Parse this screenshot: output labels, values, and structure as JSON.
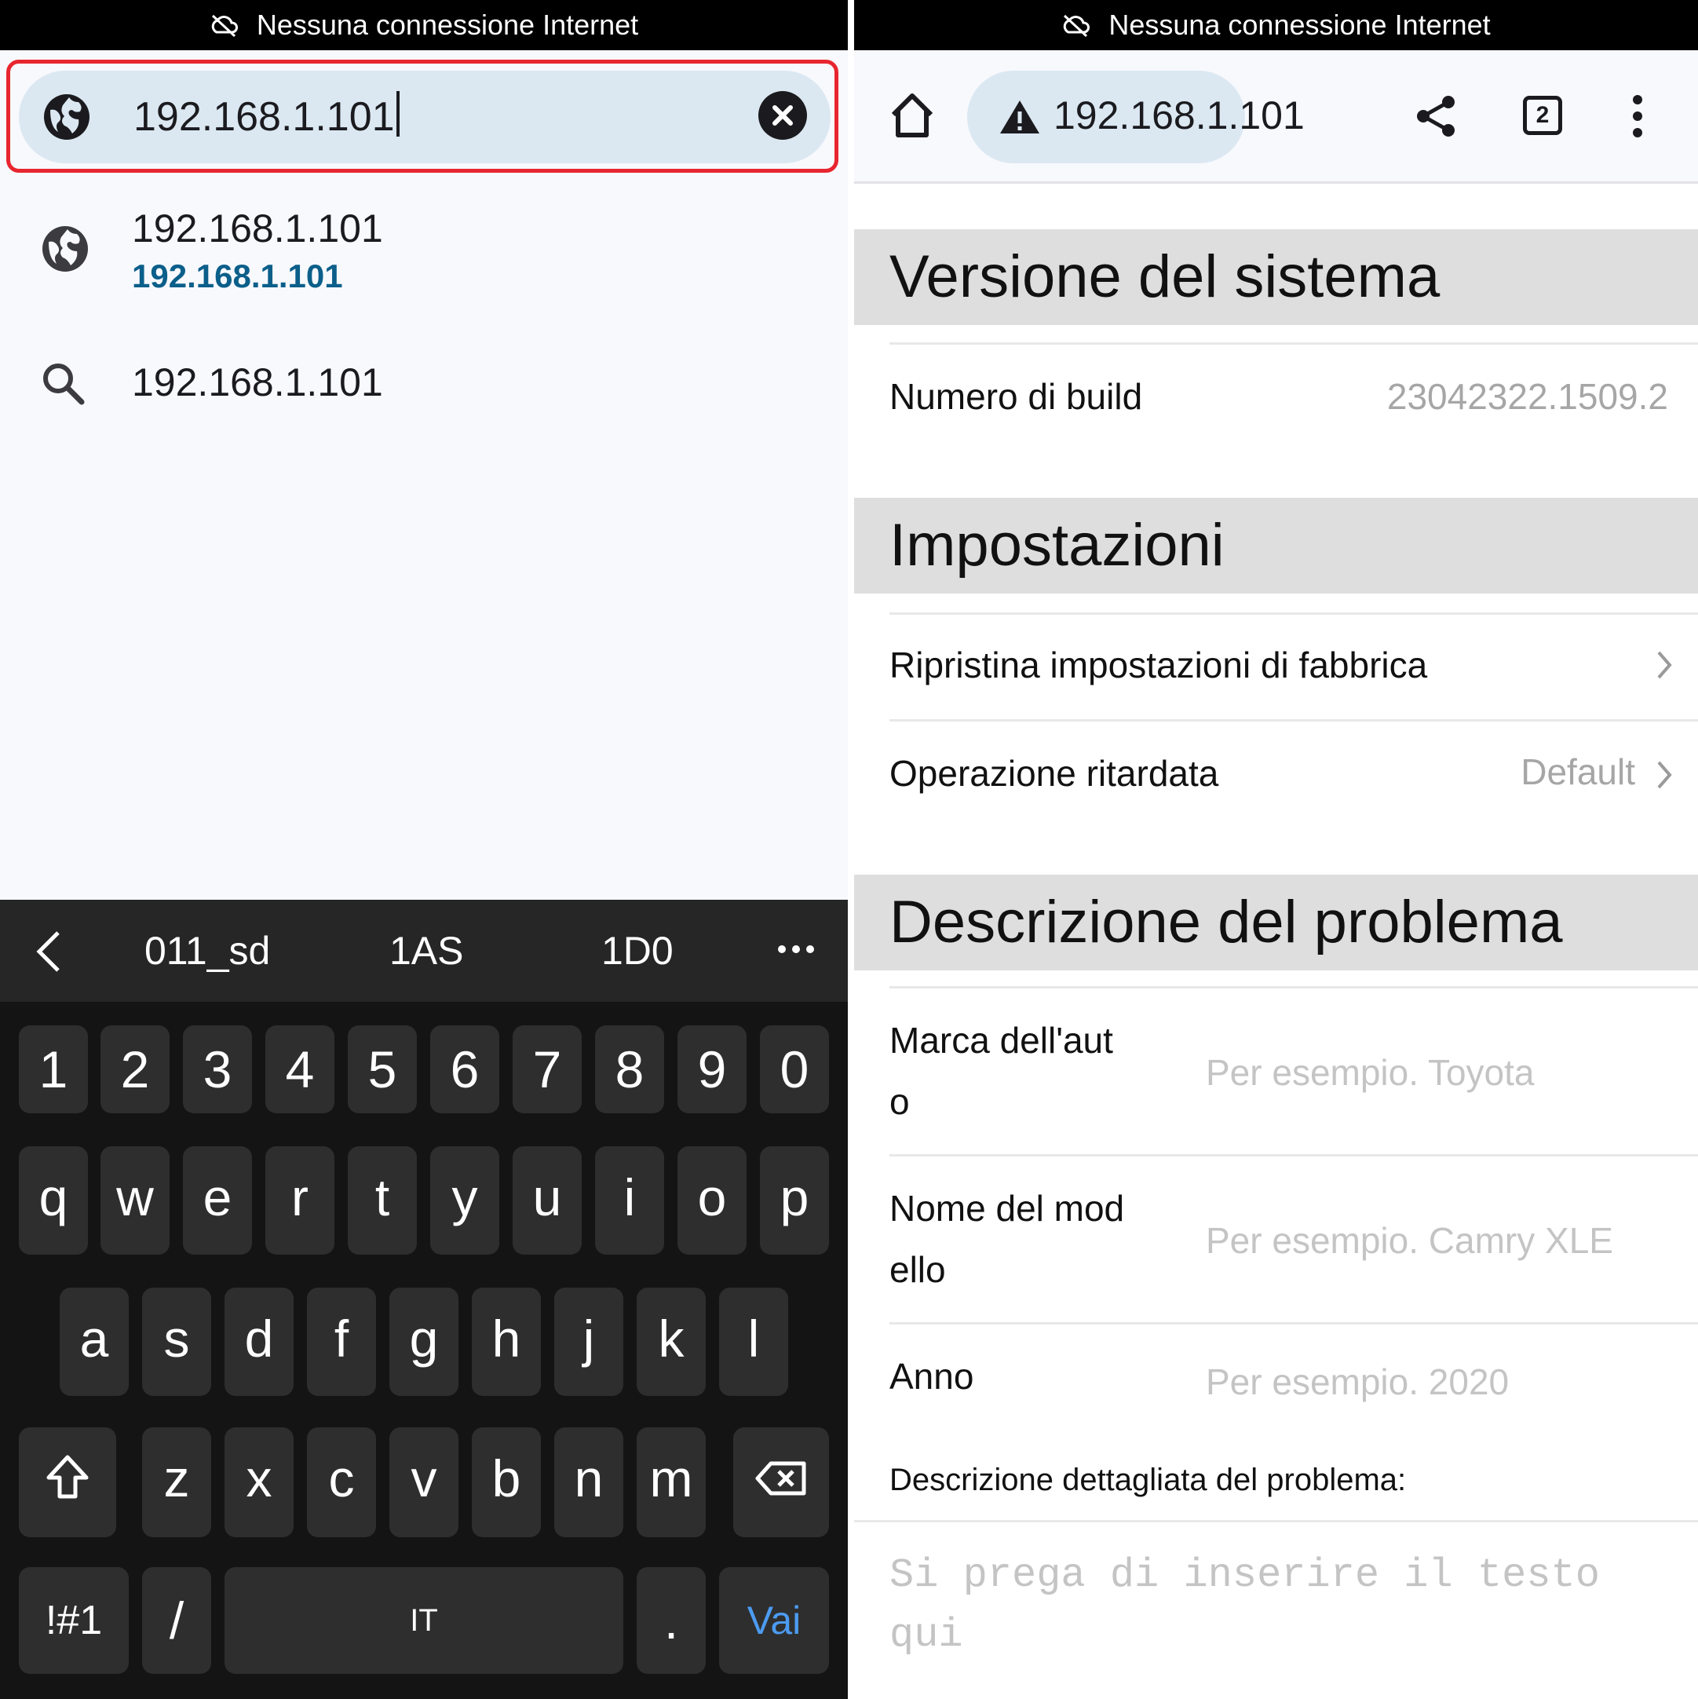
{
  "status_bar": {
    "text": "Nessuna connessione Internet"
  },
  "left": {
    "omnibox": {
      "value": "192.168.1.101"
    },
    "suggestions": [
      {
        "title": "192.168.1.101",
        "url": "192.168.1.101",
        "icon": "globe-icon"
      },
      {
        "title": "192.168.1.101",
        "icon": "search-icon"
      }
    ],
    "keyboard": {
      "predictions": [
        "011_sd",
        "1AS",
        "1D0"
      ],
      "numbers": [
        "1",
        "2",
        "3",
        "4",
        "5",
        "6",
        "7",
        "8",
        "9",
        "0"
      ],
      "row1": [
        "q",
        "w",
        "e",
        "r",
        "t",
        "y",
        "u",
        "i",
        "o",
        "p"
      ],
      "row2": [
        "a",
        "s",
        "d",
        "f",
        "g",
        "h",
        "j",
        "k",
        "l"
      ],
      "row3": [
        "z",
        "x",
        "c",
        "v",
        "b",
        "n",
        "m"
      ],
      "symbols_label": "!#1",
      "slash": "/",
      "space_label": "IT",
      "period": ".",
      "go_label": "Vai"
    }
  },
  "right": {
    "address": "192.168.1.101",
    "tab_count": "2",
    "sections": {
      "system_version": {
        "title": "Versione del sistema",
        "build_label": "Numero di build",
        "build_value": "23042322.1509.2"
      },
      "settings": {
        "title": "Impostazioni",
        "factory_reset": "Ripristina impostazioni di fabbrica",
        "delayed_op_label": "Operazione ritardata",
        "delayed_op_value": "Default"
      },
      "problem": {
        "title": "Descrizione del problema",
        "brand_label_l1": "Marca dell'aut",
        "brand_label_l2": "o",
        "brand_placeholder": "Per esempio. Toyota",
        "model_label_l1": "Nome del mod",
        "model_label_l2": "ello",
        "model_placeholder": "Per esempio. Camry XLE",
        "year_label": "Anno",
        "year_placeholder": "Per esempio. 2020",
        "detail_label": "Descrizione dettagliata del problema:",
        "detail_placeholder_l1": "Si prega di inserire il testo",
        "detail_placeholder_l2": "qui"
      }
    }
  },
  "colors": {
    "accent_red": "#e8262f",
    "link_blue": "#0b5f8a",
    "go_blue": "#4c9bf0",
    "header_gray": "#dedede"
  }
}
